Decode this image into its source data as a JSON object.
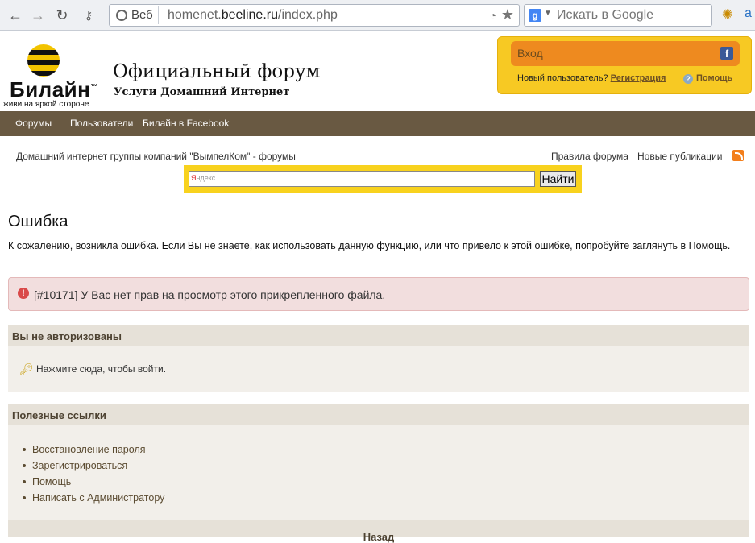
{
  "browser": {
    "url_chip": "Веб",
    "url_domain": "beeline.ru",
    "url_prefix": "homenet.",
    "url_suffix": "/index.php",
    "search_placeholder": "Искать в Google",
    "google_letter": "g"
  },
  "header": {
    "brand": "Билайн",
    "brand_tm": "™",
    "slogan": "живи на яркой стороне",
    "title": "Официальный форум",
    "subtitle": "Услуги Домашний Интернет",
    "login_label": "Вход",
    "fb_letter": "f",
    "new_user_text": "Новый пользователь?",
    "register_link": "Регистрация",
    "help_link": "Помощь"
  },
  "nav": {
    "items": [
      "Форумы",
      "Пользователи",
      "Билайн в Facebook"
    ]
  },
  "breadcrumb": {
    "text": "Домашний интернет группы компаний \"ВымпелКом\" - форумы",
    "rules": "Правила форума",
    "new_posts": "Новые публикации"
  },
  "yandex": {
    "placeholder_red": "Я",
    "placeholder_gray": "ндекс",
    "button": "Найти"
  },
  "content": {
    "heading": "Ошибка",
    "intro": "К сожалению, возникла ошибка. Если Вы не знаете, как использовать данную функцию, или что привело к этой ошибке, попробуйте заглянуть в Помощь.",
    "alert": "[#10171] У Вас нет прав на просмотр этого прикрепленного файла.",
    "not_authorized_title": "Вы не авторизованы",
    "login_prompt": "Нажмите сюда, чтобы войти.",
    "useful_links_title": "Полезные ссылки",
    "useful_links": [
      "Восстановление пароля",
      "Зарегистрироваться",
      "Помощь",
      "Написать с Администратору"
    ],
    "back": "Назад"
  },
  "colors": {
    "navbar": "#695942",
    "login_box": "#f7c923",
    "login_button": "#ee8a1f",
    "alert_bg": "#f2dede",
    "panel_head": "#e6e1d8"
  }
}
